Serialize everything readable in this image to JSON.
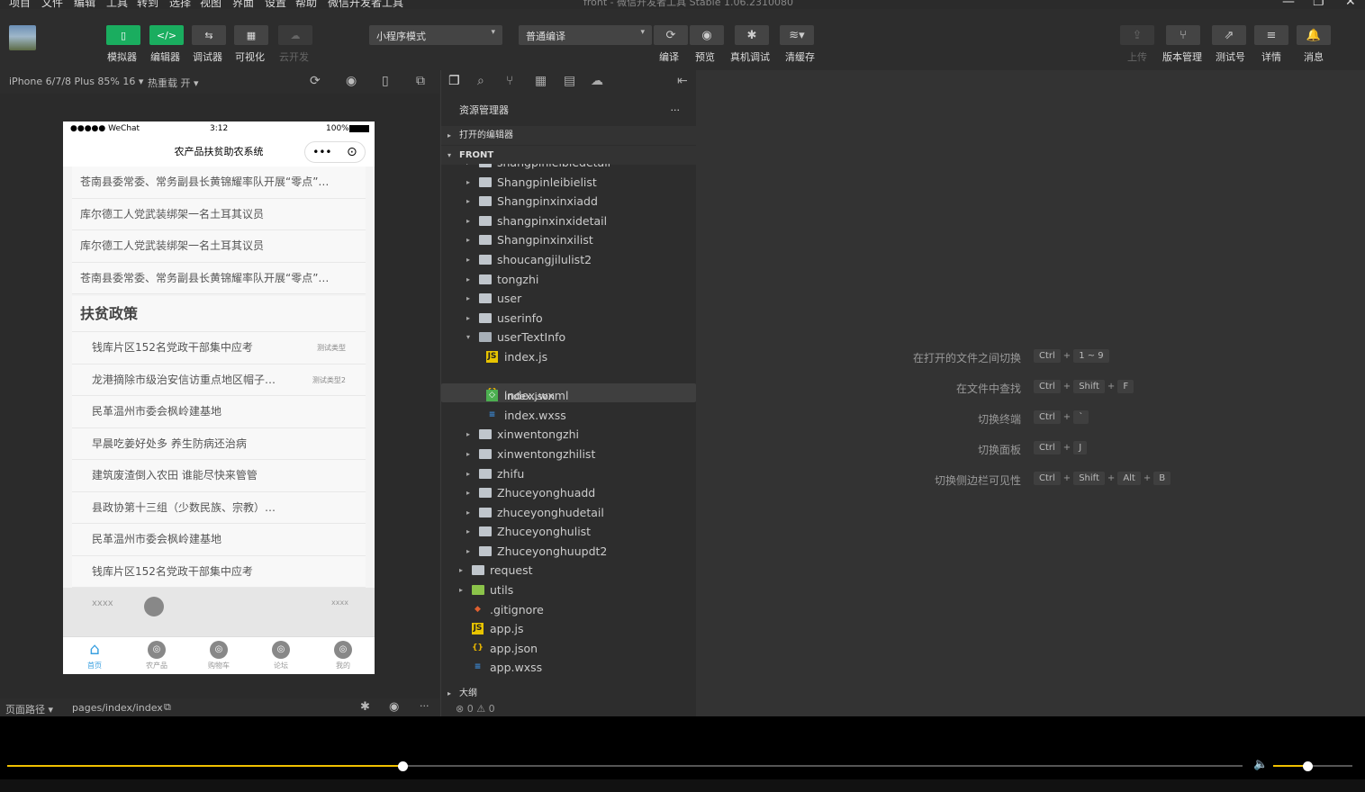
{
  "menu": [
    "项目",
    "文件",
    "编辑",
    "工具",
    "转到",
    "选择",
    "视图",
    "界面",
    "设置",
    "帮助",
    "微信开发者工具"
  ],
  "window_title": "front - 微信开发者工具 Stable 1.06.2310080",
  "toolbar": {
    "buttons": [
      {
        "label": "模拟器",
        "icon": "▯"
      },
      {
        "label": "编辑器",
        "icon": "</>"
      },
      {
        "label": "调试器",
        "icon": "⇆"
      },
      {
        "label": "可视化",
        "icon": "▦"
      },
      {
        "label": "云开发",
        "icon": "☁"
      }
    ],
    "mode_select": "小程序模式",
    "compile_select": "普通编译",
    "actions": [
      {
        "label": "编译",
        "icon": "⟳"
      },
      {
        "label": "预览",
        "icon": "◉"
      },
      {
        "label": "真机调试",
        "icon": "✱"
      },
      {
        "label": "清缓存",
        "icon": "≋▾"
      }
    ],
    "right_buttons": [
      {
        "label": "上传",
        "icon": "⇪"
      },
      {
        "label": "版本管理",
        "icon": "⑂"
      },
      {
        "label": "测试号",
        "icon": "⇗"
      },
      {
        "label": "详情",
        "icon": "≡"
      },
      {
        "label": "消息",
        "icon": "🔔"
      }
    ]
  },
  "simulator": {
    "device": "iPhone 6/7/8 Plus 85% 16 ▾",
    "hot_reload": "热重载 开 ▾",
    "status": {
      "carrier": "●●●●● WeChat",
      "time": "3:12",
      "battery": "100%"
    },
    "nav_title": "农产品扶贫助农系统",
    "news": [
      "苍南县委常委、常务副县长黄锦耀率队开展“零点”…",
      "库尔德工人党武装绑架一名土耳其议员",
      "库尔德工人党武装绑架一名土耳其议员",
      "苍南县委常委、常务副县长黄锦耀率队开展“零点”…"
    ],
    "policy_title": "扶贫政策",
    "policies": [
      {
        "text": "钱库片区152名党政干部集中应考",
        "tag": "测试类型"
      },
      {
        "text": "龙港摘除市级治安信访重点地区帽子…",
        "tag": "测试类型2"
      },
      {
        "text": "民革温州市委会枫岭建基地",
        "tag": ""
      },
      {
        "text": "早晨吃姜好处多 养生防病还治病",
        "tag": ""
      },
      {
        "text": "建筑废渣倒入农田 谁能尽快来管管",
        "tag": ""
      },
      {
        "text": "县政协第十三组（少数民族、宗教）…",
        "tag": ""
      },
      {
        "text": "民革温州市委会枫岭建基地",
        "tag": ""
      },
      {
        "text": "钱库片区152名党政干部集中应考",
        "tag": ""
      }
    ],
    "bottom_left": "xxxx",
    "bottom_right": "xxxx",
    "tabs": [
      {
        "label": "首页",
        "icon": "⌂"
      },
      {
        "label": "农产品",
        "icon": "◎"
      },
      {
        "label": "购物车",
        "icon": "◎"
      },
      {
        "label": "论坛",
        "icon": "◎"
      },
      {
        "label": "我的",
        "icon": "◎"
      }
    ],
    "footer_path_label": "页面路径 ▾",
    "footer_path": "pages/index/index"
  },
  "explorer": {
    "title": "资源管理器",
    "more": "···",
    "open_editors": "打开的编辑器",
    "root": "FRONT",
    "items": [
      {
        "name": "shangpinleibiedetail",
        "type": "folder",
        "level": 1,
        "arrow": "▸"
      },
      {
        "name": "Shangpinleibielist",
        "type": "folder",
        "level": 1,
        "arrow": "▸"
      },
      {
        "name": "Shangpinxinxiadd",
        "type": "folder",
        "level": 1,
        "arrow": "▸"
      },
      {
        "name": "shangpinxinxidetail",
        "type": "folder",
        "level": 1,
        "arrow": "▸"
      },
      {
        "name": "Shangpinxinxilist",
        "type": "folder",
        "level": 1,
        "arrow": "▸"
      },
      {
        "name": "shoucangjilulist2",
        "type": "folder",
        "level": 1,
        "arrow": "▸"
      },
      {
        "name": "tongzhi",
        "type": "folder",
        "level": 1,
        "arrow": "▸"
      },
      {
        "name": "user",
        "type": "folder",
        "level": 1,
        "arrow": "▸"
      },
      {
        "name": "userinfo",
        "type": "folder",
        "level": 1,
        "arrow": "▸"
      },
      {
        "name": "userTextInfo",
        "type": "folder-open",
        "level": 1,
        "arrow": "▾"
      },
      {
        "name": "index.js",
        "type": "js",
        "level": 2,
        "arrow": ""
      },
      {
        "name": "index.json",
        "type": "json",
        "level": 2,
        "arrow": "",
        "selected": true
      },
      {
        "name": "index.wxml",
        "type": "wxml",
        "level": 2,
        "arrow": ""
      },
      {
        "name": "index.wxss",
        "type": "wxss",
        "level": 2,
        "arrow": ""
      },
      {
        "name": "xinwentongzhi",
        "type": "folder",
        "level": 1,
        "arrow": "▸"
      },
      {
        "name": "xinwentongzhilist",
        "type": "folder",
        "level": 1,
        "arrow": "▸"
      },
      {
        "name": "zhifu",
        "type": "folder",
        "level": 1,
        "arrow": "▸"
      },
      {
        "name": "Zhuceyonghuadd",
        "type": "folder",
        "level": 1,
        "arrow": "▸"
      },
      {
        "name": "zhuceyonghudetail",
        "type": "folder",
        "level": 1,
        "arrow": "▸"
      },
      {
        "name": "Zhuceyonghulist",
        "type": "folder",
        "level": 1,
        "arrow": "▸"
      },
      {
        "name": "Zhuceyonghuupdt2",
        "type": "folder",
        "level": 1,
        "arrow": "▸"
      },
      {
        "name": "request",
        "type": "folder",
        "level": 0,
        "arrow": "▸"
      },
      {
        "name": "utils",
        "type": "folder-green",
        "level": 0,
        "arrow": "▸"
      },
      {
        "name": ".gitignore",
        "type": "git",
        "level": 0,
        "arrow": ""
      },
      {
        "name": "app.js",
        "type": "js",
        "level": 0,
        "arrow": ""
      },
      {
        "name": "app.json",
        "type": "json",
        "level": 0,
        "arrow": ""
      },
      {
        "name": "app.wxss",
        "type": "wxss",
        "level": 0,
        "arrow": ""
      }
    ],
    "outline": "大纲",
    "problems": "⊗ 0 ⚠ 0"
  },
  "editor": {
    "hints": [
      {
        "label": "在打开的文件之间切换",
        "keys": [
          "Ctrl",
          "1 ~ 9"
        ]
      },
      {
        "label": "在文件中查找",
        "keys": [
          "Ctrl",
          "Shift",
          "F"
        ]
      },
      {
        "label": "切换终端",
        "keys": [
          "Ctrl",
          "`"
        ]
      },
      {
        "label": "切换面板",
        "keys": [
          "Ctrl",
          "J"
        ]
      },
      {
        "label": "切换侧边栏可见性",
        "keys": [
          "Ctrl",
          "Shift",
          "Alt",
          "B"
        ]
      }
    ]
  },
  "player": {
    "progress": 0.32,
    "volume": 0.43
  }
}
